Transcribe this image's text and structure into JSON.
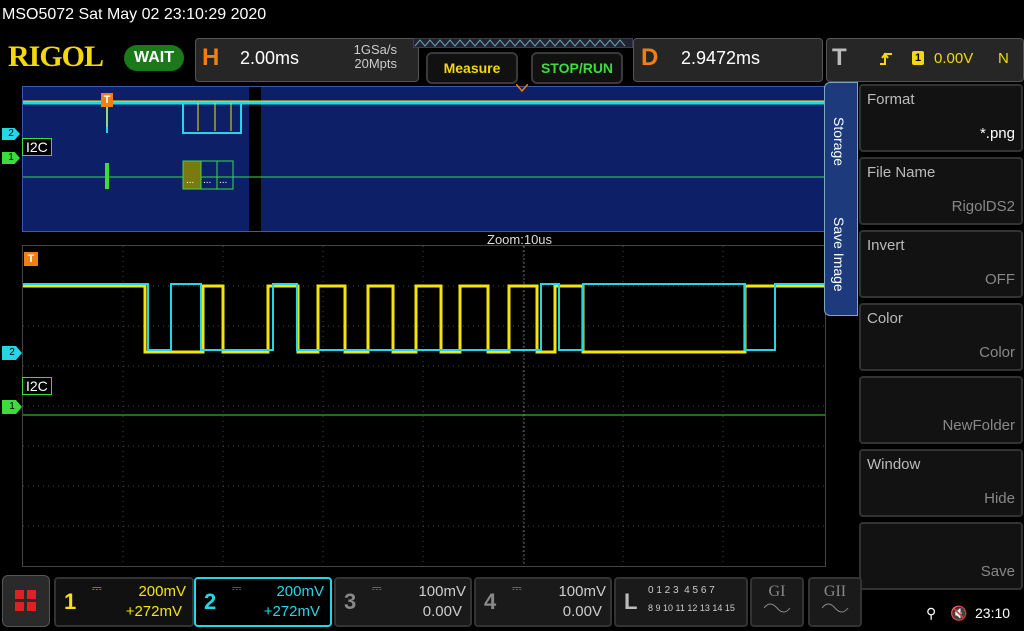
{
  "header": {
    "model_datetime": "MSO5072  Sat May 02 23:10:29 2020",
    "brand": "RIGOL",
    "run_status": "WAIT",
    "horizontal": {
      "label": "H",
      "timebase": "2.00ms",
      "sample_rate": "1GSa/s",
      "memory_depth": "20Mpts"
    },
    "measure_label": "Measure",
    "stop_run_label": "STOP/RUN",
    "delay": {
      "label": "D",
      "value": "2.9472ms"
    },
    "trigger": {
      "label": "T",
      "source": "1",
      "level": "0.00V",
      "mode": "N"
    }
  },
  "display": {
    "zoom_label": "Zoom:10us",
    "decode_tag_top": "I2C",
    "decode_tag_main": "I2C",
    "marker_1": "1",
    "marker_2": "2",
    "trigger_marker": "T"
  },
  "menu": {
    "side_tab_1": "Storage",
    "side_tab_2": "Save Image",
    "items": [
      {
        "title": "Format",
        "value": "*.png"
      },
      {
        "title": "File Name",
        "value": "RigolDS2"
      },
      {
        "title": "Invert",
        "value": "OFF"
      },
      {
        "title": "Color",
        "value": "Color"
      },
      {
        "title": "",
        "value": "NewFolder"
      },
      {
        "title": "Window",
        "value": "Hide"
      },
      {
        "title": "",
        "value": "Save"
      }
    ]
  },
  "channels": [
    {
      "num": "1",
      "scale": "200mV",
      "offset": "+272mV",
      "color": "#f4e40a",
      "active": true
    },
    {
      "num": "2",
      "scale": "200mV",
      "offset": "+272mV",
      "color": "#23d6e8",
      "active": true
    },
    {
      "num": "3",
      "scale": "100mV",
      "offset": "0.00V",
      "color": "#888888",
      "active": false
    },
    {
      "num": "4",
      "scale": "100mV",
      "offset": "0.00V",
      "color": "#888888",
      "active": false
    }
  ],
  "logic": {
    "label": "L",
    "row1": "0 1 2 3  4 5 6 7",
    "row2": "8 9 10 11 12 13 14 15"
  },
  "gen1": "GI",
  "gen2": "GII",
  "status_bar": {
    "time": "23:10"
  },
  "colors": {
    "ch1": "#f4e40a",
    "ch2": "#23d6e8",
    "digital": "#3ddc3d",
    "accent": "#f07e10"
  }
}
